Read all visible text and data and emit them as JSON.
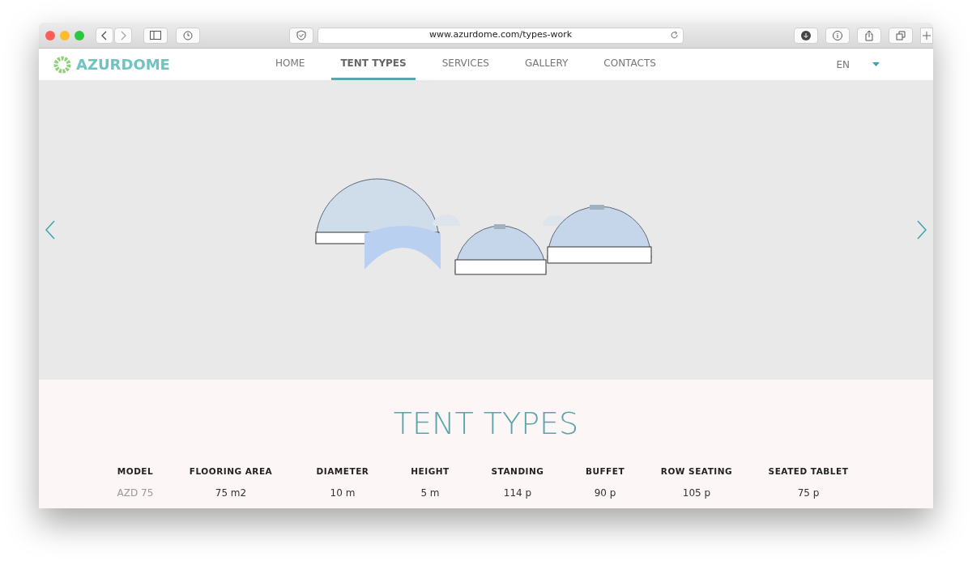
{
  "browser": {
    "url": "www.azurdome.com/types-work"
  },
  "site": {
    "logo": "AZURDOME",
    "language": "EN",
    "nav": [
      {
        "label": "HOME",
        "selected": false
      },
      {
        "label": "TENT TYPES",
        "selected": true
      },
      {
        "label": "SERVICES",
        "selected": false
      },
      {
        "label": "GALLERY",
        "selected": false
      },
      {
        "label": "CONTACTS",
        "selected": false
      }
    ]
  },
  "section": {
    "title": "TENT TYPES",
    "table": {
      "columns": [
        "MODEL",
        "FLOORING AREA",
        "DIAMETER",
        "HEIGHT",
        "STANDING",
        "BUFFET",
        "ROW SEATING",
        "SEATED TABLET"
      ],
      "rows": [
        [
          "AZD 75",
          "75 m2",
          "10 m",
          "5 m",
          "114 p",
          "90 p",
          "105 p",
          "75 p"
        ]
      ]
    }
  }
}
